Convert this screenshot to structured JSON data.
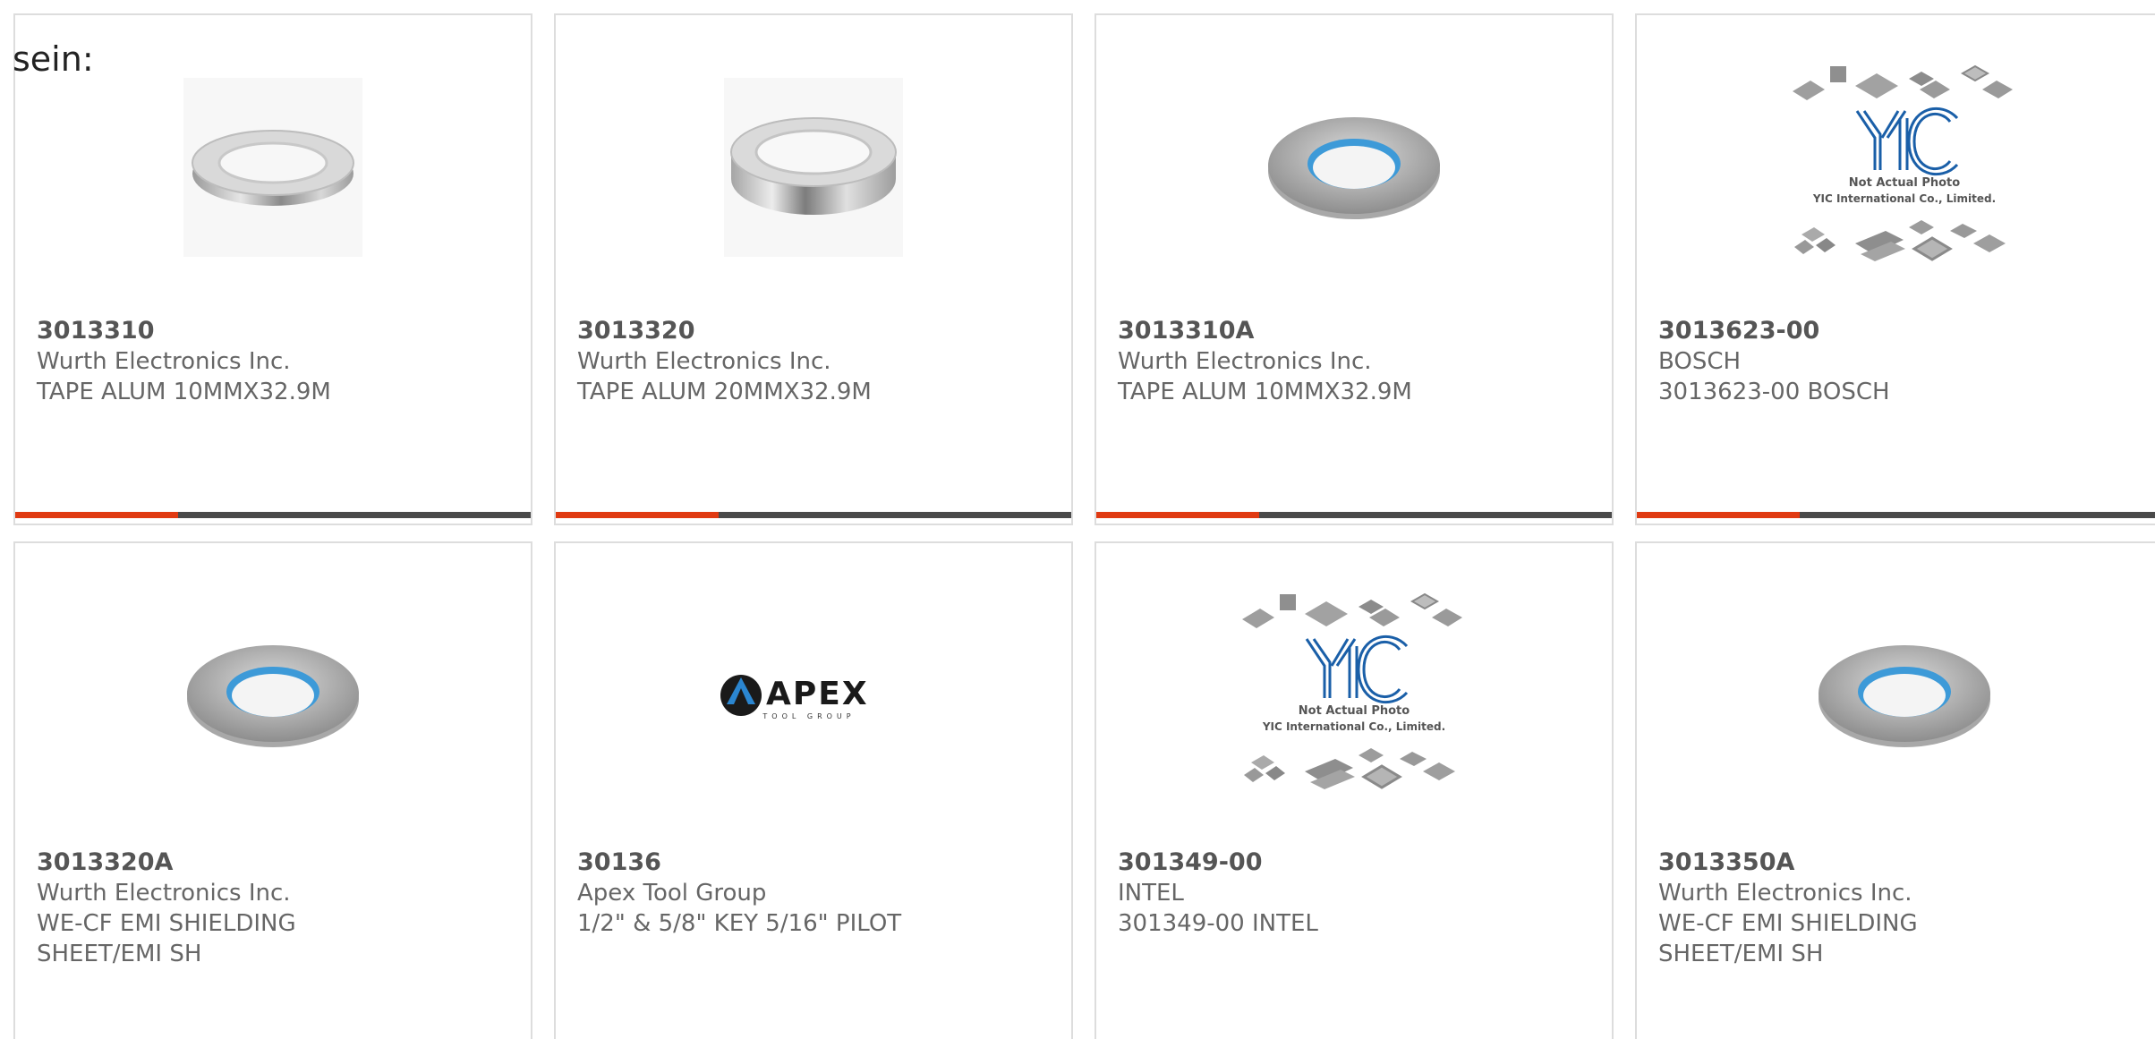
{
  "header": {
    "label": "sein:"
  },
  "products": [
    {
      "part": "3013310",
      "manufacturer": "Wurth Electronics Inc.",
      "desc1": "TAPE ALUM 10MMX32.9M",
      "desc2": "",
      "image": "silver-tape-roll-photo",
      "has_bar": true
    },
    {
      "part": "3013320",
      "manufacturer": "Wurth Electronics Inc.",
      "desc1": "TAPE ALUM 20MMX32.9M",
      "desc2": "",
      "image": "silver-tape-roll-wide-photo",
      "has_bar": true
    },
    {
      "part": "3013310A",
      "manufacturer": "Wurth Electronics Inc.",
      "desc1": "TAPE ALUM 10MMX32.9M",
      "desc2": "",
      "image": "tape-roll-blue-core-photo",
      "has_bar": true
    },
    {
      "part": "3013623-00",
      "manufacturer": "BOSCH",
      "desc1": "3013623-00 BOSCH",
      "desc2": "",
      "image": "yic-placeholder",
      "placeholder_line1": "Not Actual Photo",
      "placeholder_line2": "YIC International Co., Limited.",
      "has_bar": true
    },
    {
      "part": "3013320A",
      "manufacturer": "Wurth Electronics Inc.",
      "desc1": "WE-CF EMI SHIELDING",
      "desc2": "SHEET/EMI SH",
      "image": "tape-roll-blue-core-photo",
      "has_bar": false
    },
    {
      "part": "30136",
      "manufacturer": "Apex Tool Group",
      "desc1": "1/2\" & 5/8\" KEY 5/16\" PILOT",
      "desc2": "",
      "image": "apex-logo",
      "logo_text": "APEX",
      "logo_subtext": "TOOL GROUP",
      "has_bar": false
    },
    {
      "part": "301349-00",
      "manufacturer": "INTEL",
      "desc1": "301349-00 INTEL",
      "desc2": "",
      "image": "yic-placeholder",
      "placeholder_line1": "Not Actual Photo",
      "placeholder_line2": "YIC International Co., Limited.",
      "has_bar": false
    },
    {
      "part": "3013350A",
      "manufacturer": "Wurth Electronics Inc.",
      "desc1": "WE-CF EMI SHIELDING",
      "desc2": "SHEET/EMI SH",
      "image": "tape-roll-blue-core-photo",
      "has_bar": false
    }
  ],
  "colors": {
    "accent": "#e03a12",
    "bar_dark": "#4a4a4a",
    "border": "#dddddd",
    "text": "#555555",
    "yic_blue": "#1a5fa8"
  }
}
